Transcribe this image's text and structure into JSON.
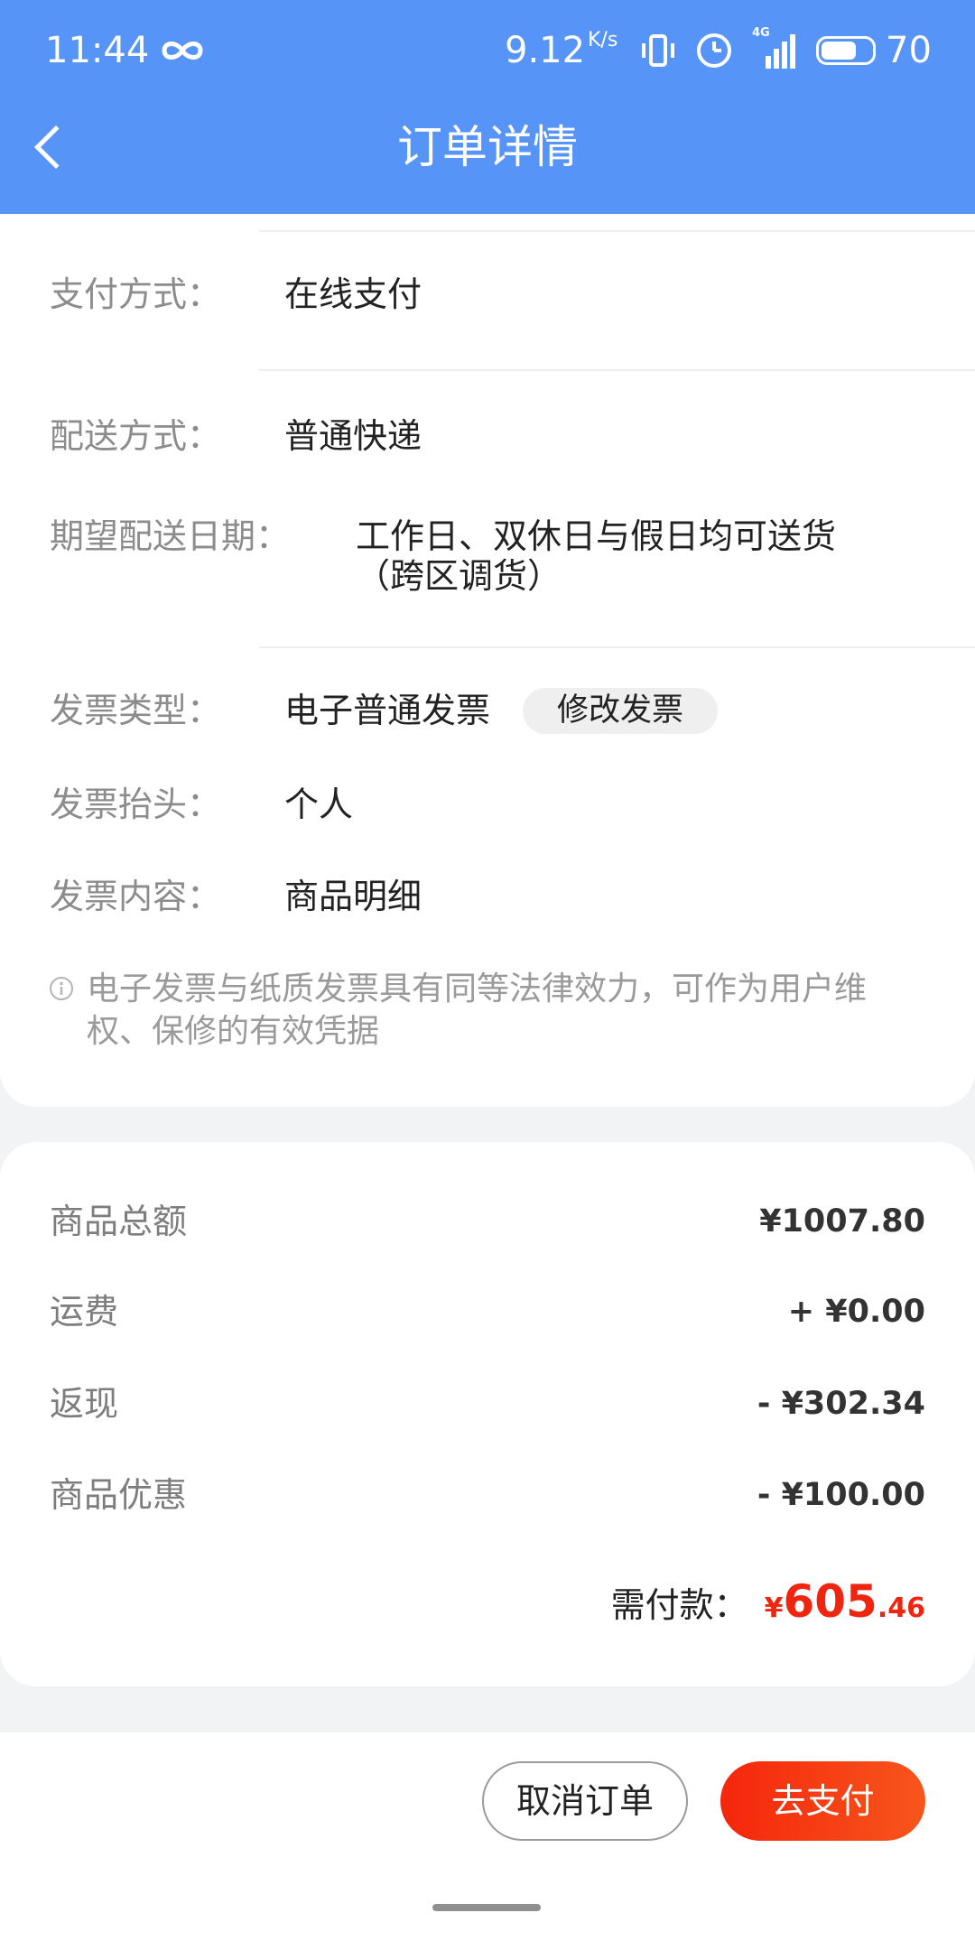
{
  "status_bar": {
    "time": "11:44",
    "speed": "9.12",
    "speed_unit": "K/s",
    "network": "4G",
    "battery": "70",
    "battery_level": 0.7,
    "icons": [
      "infinity-icon",
      "vibrate-icon",
      "alarm-icon",
      "signal-icon",
      "battery-icon"
    ]
  },
  "header": {
    "title": "订单详情",
    "back_icon": "chevron-left-icon"
  },
  "order_info": {
    "payment": {
      "label": "支付方式：",
      "value": "在线支付"
    },
    "shipping": {
      "label": "配送方式：",
      "value": "普通快递"
    },
    "delivery_date": {
      "label": "期望配送日期：",
      "value": "工作日、双休日与假日均可送货（跨区调货）"
    },
    "invoice_type": {
      "label": "发票类型：",
      "value": "电子普通发票",
      "edit_button": "修改发票"
    },
    "invoice_title": {
      "label": "发票抬头：",
      "value": "个人"
    },
    "invoice_content": {
      "label": "发票内容：",
      "value": "商品明细"
    },
    "invoice_note": "电子发票与纸质发票具有同等法律效力，可作为用户维权、保修的有效凭据",
    "note_icon": "info-icon"
  },
  "summary": {
    "rows": [
      {
        "label": "商品总额",
        "value": "¥1007.80"
      },
      {
        "label": "运费",
        "value": "+ ¥0.00"
      },
      {
        "label": "返现",
        "value": "- ¥302.34"
      },
      {
        "label": "商品优惠",
        "value": "- ¥100.00"
      }
    ],
    "total_label": "需付款：",
    "total_currency": "¥",
    "total_integer": "605",
    "total_decimal": ".46"
  },
  "actions": {
    "cancel": "取消订单",
    "pay": "去支付"
  },
  "colors": {
    "accent": "#5694f7",
    "price": "#f0250f",
    "pay-start": "#f5260c",
    "pay-end": "#f7561c"
  }
}
